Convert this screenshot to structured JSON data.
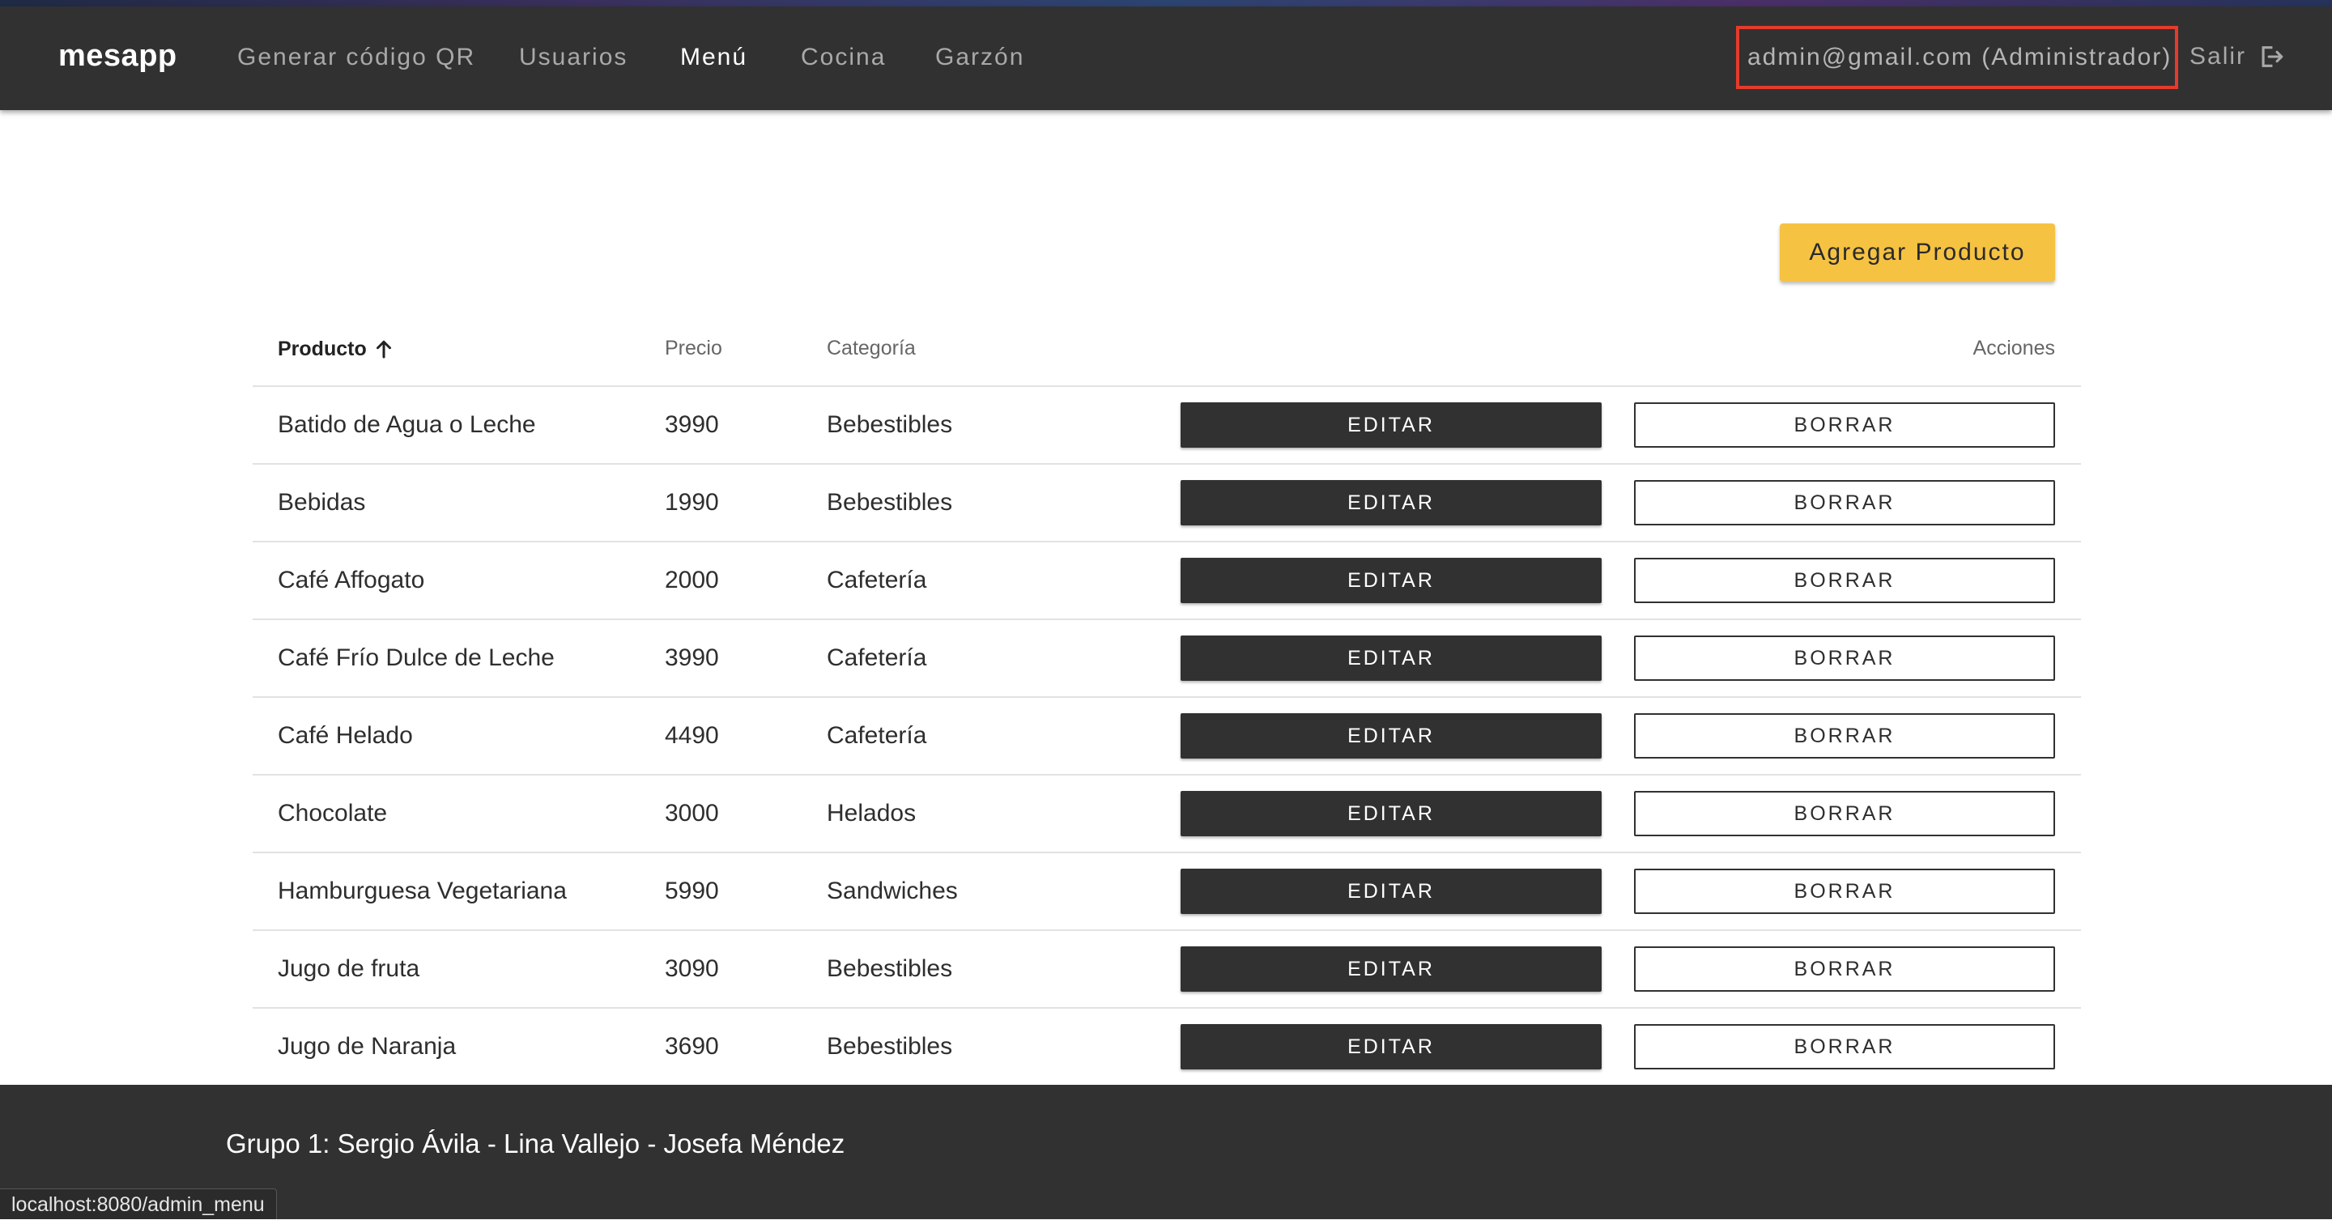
{
  "nav": {
    "brand": "mesapp",
    "links": [
      "Generar código QR",
      "Usuarios",
      "Menú",
      "Cocina",
      "Garzón"
    ],
    "user": "admin@gmail.com (Administrador)",
    "logout": "Salir"
  },
  "toolbar": {
    "add_label": "Agregar Producto"
  },
  "table": {
    "headers": {
      "product": "Producto",
      "price": "Precio",
      "category": "Categoría",
      "actions": "Acciones"
    },
    "edit_label": "EDITAR",
    "delete_label": "BORRAR",
    "rows": [
      {
        "product": "Batido de Agua o Leche",
        "price": "3990",
        "category": "Bebestibles"
      },
      {
        "product": "Bebidas",
        "price": "1990",
        "category": "Bebestibles"
      },
      {
        "product": "Café Affogato",
        "price": "2000",
        "category": "Cafetería"
      },
      {
        "product": "Café Frío Dulce de Leche",
        "price": "3990",
        "category": "Cafetería"
      },
      {
        "product": "Café Helado",
        "price": "4490",
        "category": "Cafetería"
      },
      {
        "product": "Chocolate",
        "price": "3000",
        "category": "Helados"
      },
      {
        "product": "Hamburguesa Vegetariana",
        "price": "5990",
        "category": "Sandwiches"
      },
      {
        "product": "Jugo de fruta",
        "price": "3090",
        "category": "Bebestibles"
      },
      {
        "product": "Jugo de Naranja",
        "price": "3690",
        "category": "Bebestibles"
      }
    ]
  },
  "footer": {
    "text": "Grupo 1: Sergio Ávila - Lina Vallejo - Josefa Méndez"
  },
  "status_bar": {
    "url": "localhost:8080/admin_menu"
  },
  "colors": {
    "navbar": "#323131",
    "accent": "#f5c242",
    "highlight": "#e53b2c"
  },
  "icons": {
    "logout": "logout-icon",
    "sort": "arrow-up-icon"
  }
}
